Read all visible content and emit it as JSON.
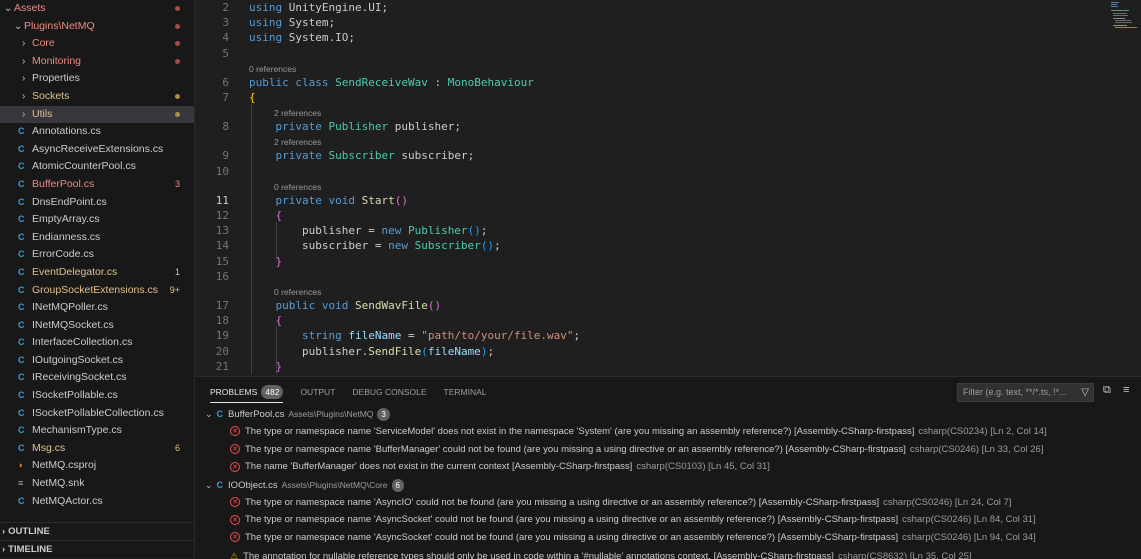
{
  "sidebar": {
    "tree": [
      {
        "label": "Assets",
        "type": "folder",
        "open": true,
        "depth": 0,
        "color": "red",
        "mark": "dot"
      },
      {
        "label": "Plugins\\NetMQ",
        "type": "folder",
        "open": true,
        "depth": 1,
        "color": "red",
        "mark": "dot"
      },
      {
        "label": "Core",
        "type": "folder",
        "open": false,
        "depth": 2,
        "color": "red",
        "mark": "dot"
      },
      {
        "label": "Monitoring",
        "type": "folder",
        "open": false,
        "depth": 2,
        "color": "red",
        "mark": "dot"
      },
      {
        "label": "Properties",
        "type": "folder",
        "open": false,
        "depth": 2,
        "color": "plain",
        "mark": ""
      },
      {
        "label": "Sockets",
        "type": "folder",
        "open": false,
        "depth": 2,
        "color": "yellow",
        "mark": "dot"
      },
      {
        "label": "Utils",
        "type": "folder",
        "open": false,
        "depth": 2,
        "color": "yellow",
        "mark": "dot",
        "selected": true
      },
      {
        "label": "Annotations.cs",
        "type": "cs",
        "color": "plain",
        "mark": ""
      },
      {
        "label": "AsyncReceiveExtensions.cs",
        "type": "cs",
        "color": "plain",
        "mark": ""
      },
      {
        "label": "AtomicCounterPool.cs",
        "type": "cs",
        "color": "plain",
        "mark": ""
      },
      {
        "label": "BufferPool.cs",
        "type": "cs",
        "color": "red",
        "mark": "3"
      },
      {
        "label": "DnsEndPoint.cs",
        "type": "cs",
        "color": "plain",
        "mark": ""
      },
      {
        "label": "EmptyArray.cs",
        "type": "cs",
        "color": "plain",
        "mark": ""
      },
      {
        "label": "Endianness.cs",
        "type": "cs",
        "color": "plain",
        "mark": ""
      },
      {
        "label": "ErrorCode.cs",
        "type": "cs",
        "color": "plain",
        "mark": ""
      },
      {
        "label": "EventDelegator.cs",
        "type": "cs",
        "color": "yellow",
        "mark": "1"
      },
      {
        "label": "GroupSocketExtensions.cs",
        "type": "cs",
        "color": "yellow",
        "mark": "9+"
      },
      {
        "label": "INetMQPoller.cs",
        "type": "cs",
        "color": "plain",
        "mark": ""
      },
      {
        "label": "INetMQSocket.cs",
        "type": "cs",
        "color": "plain",
        "mark": ""
      },
      {
        "label": "InterfaceCollection.cs",
        "type": "cs",
        "color": "plain",
        "mark": ""
      },
      {
        "label": "IOutgoingSocket.cs",
        "type": "cs",
        "color": "plain",
        "mark": ""
      },
      {
        "label": "IReceivingSocket.cs",
        "type": "cs",
        "color": "plain",
        "mark": ""
      },
      {
        "label": "ISocketPollable.cs",
        "type": "cs",
        "color": "plain",
        "mark": ""
      },
      {
        "label": "ISocketPollableCollection.cs",
        "type": "cs",
        "color": "plain",
        "mark": ""
      },
      {
        "label": "MechanismType.cs",
        "type": "cs",
        "color": "plain",
        "mark": ""
      },
      {
        "label": "Msg.cs",
        "type": "cs",
        "color": "yellow",
        "mark": "6"
      },
      {
        "label": "NetMQ.csproj",
        "type": "rss",
        "color": "plain",
        "mark": ""
      },
      {
        "label": "NetMQ.snk",
        "type": "lines",
        "color": "plain",
        "mark": ""
      },
      {
        "label": "NetMQActor.cs",
        "type": "cs",
        "color": "plain",
        "mark": ""
      }
    ],
    "outline_label": "OUTLINE",
    "timeline_label": "TIMELINE"
  },
  "editor": {
    "active_line": "11",
    "lines": [
      {
        "n": "2",
        "tokens": [
          [
            "kw",
            "using"
          ],
          [
            "pl",
            " UnityEngine.UI;"
          ]
        ]
      },
      {
        "n": "3",
        "tokens": [
          [
            "kw",
            "using"
          ],
          [
            "pl",
            " System;"
          ]
        ]
      },
      {
        "n": "4",
        "tokens": [
          [
            "kw",
            "using"
          ],
          [
            "pl",
            " System.IO;"
          ]
        ]
      },
      {
        "n": "5",
        "tokens": []
      },
      {
        "lens": "0 references"
      },
      {
        "n": "6",
        "tokens": [
          [
            "kw",
            "public"
          ],
          [
            "pl",
            " "
          ],
          [
            "kw",
            "class"
          ],
          [
            "pl",
            " "
          ],
          [
            "ty",
            "SendReceiveWav"
          ],
          [
            "pl",
            " : "
          ],
          [
            "ty",
            "MonoBehaviour"
          ]
        ]
      },
      {
        "n": "7",
        "tokens": [
          [
            "br1",
            "{"
          ]
        ]
      },
      {
        "lens": "2 references",
        "indent": 1
      },
      {
        "n": "8",
        "tokens": [
          [
            "pl",
            "    "
          ],
          [
            "kw",
            "private"
          ],
          [
            "pl",
            " "
          ],
          [
            "ty",
            "Publisher"
          ],
          [
            "pl",
            " publisher;"
          ]
        ]
      },
      {
        "lens": "2 references",
        "indent": 1
      },
      {
        "n": "9",
        "tokens": [
          [
            "pl",
            "    "
          ],
          [
            "kw",
            "private"
          ],
          [
            "pl",
            " "
          ],
          [
            "ty",
            "Subscriber"
          ],
          [
            "pl",
            " subscriber;"
          ]
        ]
      },
      {
        "n": "10",
        "tokens": []
      },
      {
        "lens": "0 references",
        "indent": 1
      },
      {
        "n": "11",
        "tokens": [
          [
            "pl",
            "    "
          ],
          [
            "kw",
            "private"
          ],
          [
            "pl",
            " "
          ],
          [
            "kw",
            "void"
          ],
          [
            "pl",
            " "
          ],
          [
            "fn",
            "Start"
          ],
          [
            "br2",
            "()"
          ]
        ]
      },
      {
        "n": "12",
        "tokens": [
          [
            "pl",
            "    "
          ],
          [
            "br2",
            "{"
          ]
        ]
      },
      {
        "n": "13",
        "tokens": [
          [
            "pl",
            "        publisher = "
          ],
          [
            "kw",
            "new"
          ],
          [
            "pl",
            " "
          ],
          [
            "ty",
            "Publisher"
          ],
          [
            "br3",
            "()"
          ],
          [
            "pl",
            ";"
          ]
        ]
      },
      {
        "n": "14",
        "tokens": [
          [
            "pl",
            "        subscriber = "
          ],
          [
            "kw",
            "new"
          ],
          [
            "pl",
            " "
          ],
          [
            "ty",
            "Subscriber"
          ],
          [
            "br3",
            "()"
          ],
          [
            "pl",
            ";"
          ]
        ]
      },
      {
        "n": "15",
        "tokens": [
          [
            "pl",
            "    "
          ],
          [
            "br2",
            "}"
          ]
        ]
      },
      {
        "n": "16",
        "tokens": []
      },
      {
        "lens": "0 references",
        "indent": 1
      },
      {
        "n": "17",
        "tokens": [
          [
            "pl",
            "    "
          ],
          [
            "kw",
            "public"
          ],
          [
            "pl",
            " "
          ],
          [
            "kw",
            "void"
          ],
          [
            "pl",
            " "
          ],
          [
            "fn",
            "SendWavFile"
          ],
          [
            "br2",
            "()"
          ]
        ]
      },
      {
        "n": "18",
        "tokens": [
          [
            "pl",
            "    "
          ],
          [
            "br2",
            "{"
          ]
        ]
      },
      {
        "n": "19",
        "tokens": [
          [
            "pl",
            "        "
          ],
          [
            "kw",
            "string"
          ],
          [
            "pl",
            " "
          ],
          [
            "vr",
            "fileName"
          ],
          [
            "pl",
            " = "
          ],
          [
            "st",
            "\"path/to/your/file.wav\""
          ],
          [
            "pl",
            ";"
          ]
        ]
      },
      {
        "n": "20",
        "tokens": [
          [
            "pl",
            "        publisher."
          ],
          [
            "fn",
            "SendFile"
          ],
          [
            "br3",
            "("
          ],
          [
            "vr",
            "fileName"
          ],
          [
            "br3",
            ")"
          ],
          [
            "pl",
            ";"
          ]
        ]
      },
      {
        "n": "21",
        "tokens": [
          [
            "pl",
            "    "
          ],
          [
            "br2",
            "}"
          ]
        ]
      }
    ]
  },
  "panel": {
    "tabs": [
      {
        "label": "PROBLEMS",
        "active": true,
        "badge": "482"
      },
      {
        "label": "OUTPUT",
        "active": false
      },
      {
        "label": "DEBUG CONSOLE",
        "active": false
      },
      {
        "label": "TERMINAL",
        "active": false
      }
    ],
    "filter_placeholder": "Filter (e.g. text, **/*.ts, !*...",
    "groups": [
      {
        "file": "BufferPool.cs",
        "path": "Assets\\Plugins\\NetMQ",
        "count": "3",
        "items": [
          {
            "severity": "error",
            "message": "The type or namespace name 'ServiceModel' does not exist in the namespace 'System' (are you missing an assembly reference?) [Assembly-CSharp-firstpass]",
            "source": "csharp(CS0234)  [Ln 2, Col 14]"
          },
          {
            "severity": "error",
            "message": "The type or namespace name 'BufferManager' could not be found (are you missing a using directive or an assembly reference?) [Assembly-CSharp-firstpass]",
            "source": "csharp(CS0246)  [Ln 33, Col 26]"
          },
          {
            "severity": "error",
            "message": "The name 'BufferManager' does not exist in the current context [Assembly-CSharp-firstpass]",
            "source": "csharp(CS0103)  [Ln 45, Col 31]"
          }
        ]
      },
      {
        "file": "IOObject.cs",
        "path": "Assets\\Plugins\\NetMQ\\Core",
        "count": "6",
        "items": [
          {
            "severity": "error",
            "message": "The type or namespace name 'AsyncIO' could not be found (are you missing a using directive or an assembly reference?) [Assembly-CSharp-firstpass]",
            "source": "csharp(CS0246)  [Ln 24, Col 7]"
          },
          {
            "severity": "error",
            "message": "The type or namespace name 'AsyncSocket' could not be found (are you missing a using directive or an assembly reference?) [Assembly-CSharp-firstpass]",
            "source": "csharp(CS0246)  [Ln 84, Col 31]"
          },
          {
            "severity": "error",
            "message": "The type or namespace name 'AsyncSocket' could not be found (are you missing a using directive or an assembly reference?) [Assembly-CSharp-firstpass]",
            "source": "csharp(CS0246)  [Ln 94, Col 34]"
          },
          {
            "severity": "warning",
            "message": "The annotation for nullable reference types should only be used in code within a '#nullable' annotations context. [Assembly-CSharp-firstpass]",
            "source": "csharp(CS8632)  [Ln 35, Col 25]"
          }
        ]
      }
    ]
  }
}
